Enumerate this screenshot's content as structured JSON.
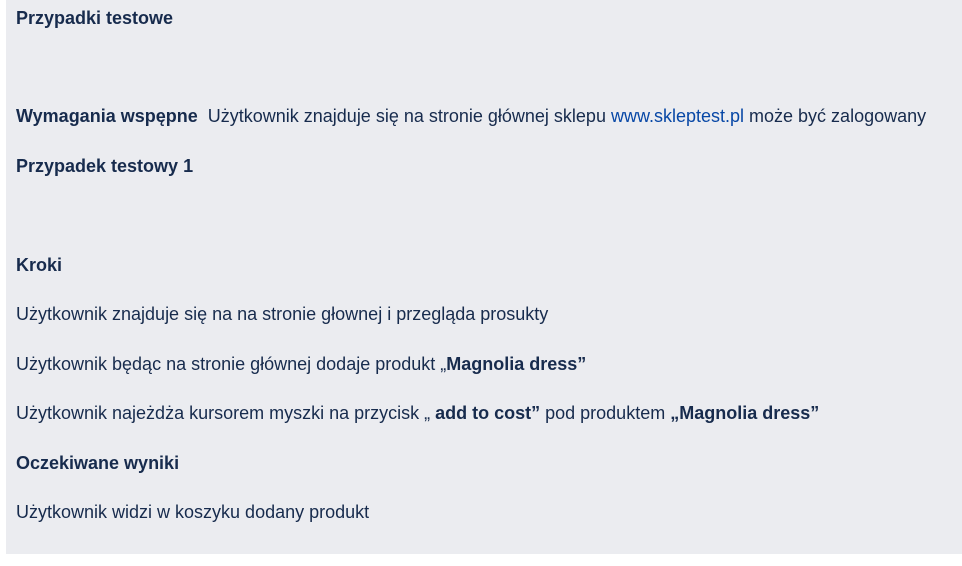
{
  "doc": {
    "heading": "Przypadki testowe",
    "preconditions": {
      "label": "Wymagania wspępne",
      "text_before": "Użytkownik znajduje się na stronie głównej sklepu ",
      "link": "www.skleptest.pl",
      "text_after": " może być zalogowany"
    },
    "test_case_title": "Przypadek testowy 1",
    "steps_label": "Kroki",
    "steps": [
      {
        "text": "Użytkownik znajduje się na na stronie głownej i przegląda prosukty"
      },
      {
        "text": "Użytkownik będąc na stronie głównej dodaje produkt „",
        "bold": "Magnolia dress”"
      },
      {
        "text": "Użytkownik najeżdża kursorem myszki na przycisk „ ",
        "bold1": "add to cost”",
        "text2": " pod produktem ",
        "bold2": "„Magnolia dress”"
      }
    ],
    "expected_label": "Oczekiwane wyniki",
    "expected_result": "Użytkownik widzi w koszyku dodany produkt"
  },
  "colors": {
    "panel_bg": "#ebecf0",
    "text": "#172b4d",
    "link": "#0747a6"
  }
}
